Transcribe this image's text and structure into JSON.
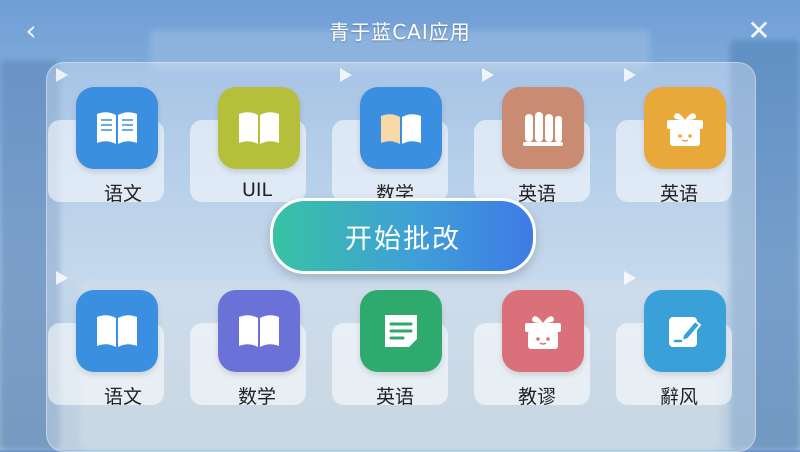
{
  "header": {
    "title": "青于蓝CAI应用",
    "back_icon": "chevron-left-icon",
    "close_icon": "close-icon"
  },
  "start_button": {
    "label": "开始批改"
  },
  "apps_row1": [
    {
      "label": "语文",
      "icon": "open-book-icon",
      "color": "#3b8fe0"
    },
    {
      "label": "UIL",
      "icon": "open-book-icon",
      "color": "#b5bf3c"
    },
    {
      "label": "数学",
      "icon": "open-book-icon",
      "color": "#3b8fe0"
    },
    {
      "label": "英语",
      "icon": "scrolls-icon",
      "color": "#c98b72"
    },
    {
      "label": "英语",
      "icon": "gift-box-icon",
      "color": "#e8a93a"
    }
  ],
  "apps_row2": [
    {
      "label": "语文",
      "icon": "open-book-icon",
      "color": "#3b8fe0"
    },
    {
      "label": "数学",
      "icon": "open-book-icon",
      "color": "#6a72d8"
    },
    {
      "label": "英语",
      "icon": "note-icon",
      "color": "#2faa6e"
    },
    {
      "label": "教谬",
      "icon": "gift-box-icon",
      "color": "#d9707a"
    },
    {
      "label": "辭风",
      "icon": "edit-icon",
      "color": "#3aa0d8"
    }
  ]
}
